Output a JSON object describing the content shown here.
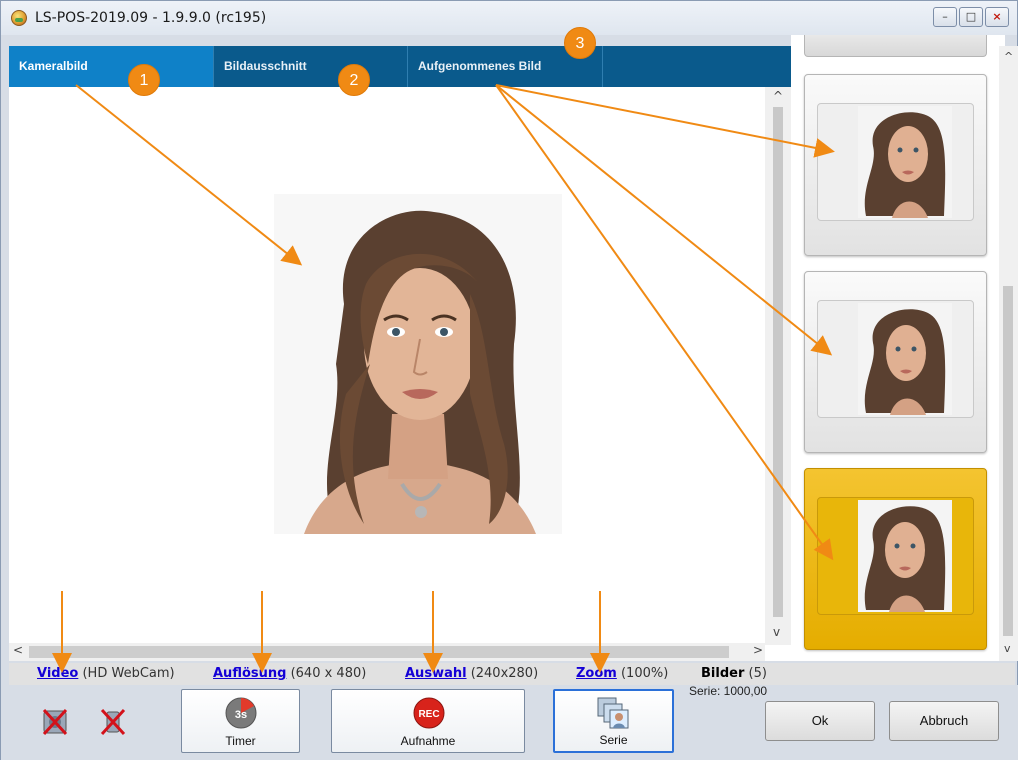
{
  "window": {
    "title": "LS-POS-2019.09 - 1.9.9.0 (rc195)",
    "min_glyph": "–",
    "max_glyph": "□",
    "close_glyph": "×"
  },
  "tabs": [
    {
      "label": "Kameralbild",
      "active": true
    },
    {
      "label": "Bildausschnitt",
      "active": false
    },
    {
      "label": "Aufgenommenes Bild",
      "active": false
    }
  ],
  "badges": [
    "1",
    "2",
    "3"
  ],
  "status": {
    "video_link": "Video",
    "video_value": "(HD WebCam)",
    "resolution_link": "Auflösung",
    "resolution_value": "(640 x 480)",
    "selection_link": "Auswahl",
    "selection_value": "(240x280)",
    "zoom_link": "Zoom",
    "zoom_value": "(100%)",
    "images_label": "Bilder",
    "images_value": "(5)"
  },
  "toolbar": {
    "timer_label": "Timer",
    "timer_icon_text": "3s",
    "record_label": "Aufnahme",
    "record_icon_text": "REC",
    "series_label": "Serie",
    "series_info": "Serie: 1000,00",
    "ok_label": "Ok",
    "cancel_label": "Abbruch"
  },
  "thumbnails": {
    "count_visible": 3,
    "selected_index": 2
  },
  "colors": {
    "tab_bg": "#0a5a8c",
    "tab_active": "#0f81c8",
    "badge": "#f08a14",
    "annotation_arrow": "#f08a14",
    "selected_card": "#f4c430",
    "link": "#1400d6"
  }
}
